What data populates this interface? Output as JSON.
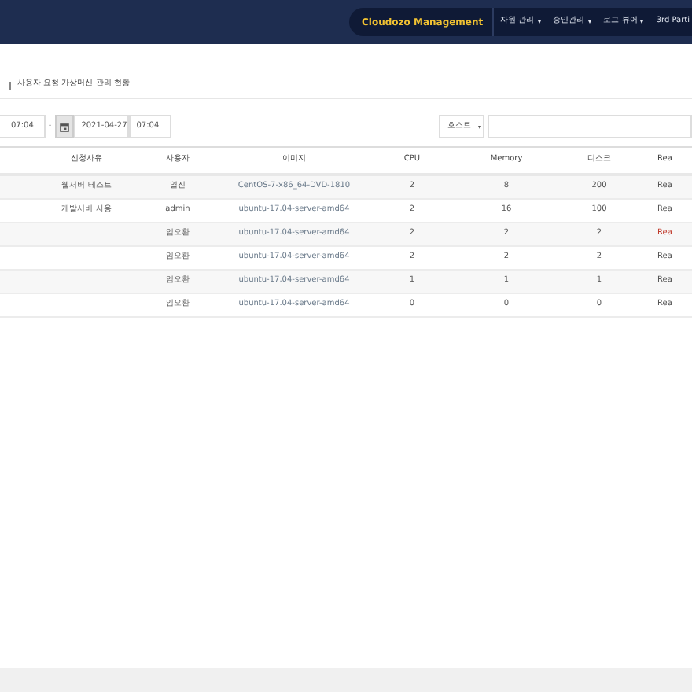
{
  "nav": {
    "brand": "Cloudozo Management",
    "menus": [
      {
        "label": "자원 관리",
        "caret": true
      },
      {
        "label": "승인관리",
        "caret": true
      },
      {
        "label": "로그 뷰어",
        "caret": true
      },
      {
        "label": "3rd Parti",
        "caret": false
      }
    ]
  },
  "page_title": "사용자 요청 가상머신 관리 현황",
  "filter": {
    "start_time": "07:04",
    "separator": "-",
    "end_date": "2021-04-27",
    "end_time": "07:04",
    "dropdown": "호스트"
  },
  "table": {
    "columns": [
      "",
      "신청사유",
      "사용자",
      "이미지",
      "CPU",
      "Memory",
      "디스크",
      "Rea"
    ],
    "rows": [
      {
        "reason": "웹서버 테스트",
        "user": "열진",
        "image": "CentOS-7-x86_64-DVD-1810",
        "cpu": "2",
        "memory": "8",
        "disk": "200",
        "status": "Rea",
        "color": "#555555"
      },
      {
        "reason": "개발서버 사용",
        "user": "admin",
        "image": "ubuntu-17.04-server-amd64",
        "cpu": "2",
        "memory": "16",
        "disk": "100",
        "status": "Rea",
        "color": "#555555"
      },
      {
        "reason": "",
        "user": "임오환",
        "image": "ubuntu-17.04-server-amd64",
        "cpu": "2",
        "memory": "2",
        "disk": "2",
        "status": "Rea",
        "color": "#c0392b"
      },
      {
        "reason": "",
        "user": "임오환",
        "image": "ubuntu-17.04-server-amd64",
        "cpu": "2",
        "memory": "2",
        "disk": "2",
        "status": "Rea",
        "color": "#555555"
      },
      {
        "reason": "",
        "user": "임오환",
        "image": "ubuntu-17.04-server-amd64",
        "cpu": "1",
        "memory": "1",
        "disk": "1",
        "status": "Rea",
        "color": "#555555"
      },
      {
        "reason": "",
        "user": "임오환",
        "image": "ubuntu-17.04-server-amd64",
        "cpu": "0",
        "memory": "0",
        "disk": "0",
        "status": "Rea",
        "color": "#555555"
      }
    ]
  }
}
